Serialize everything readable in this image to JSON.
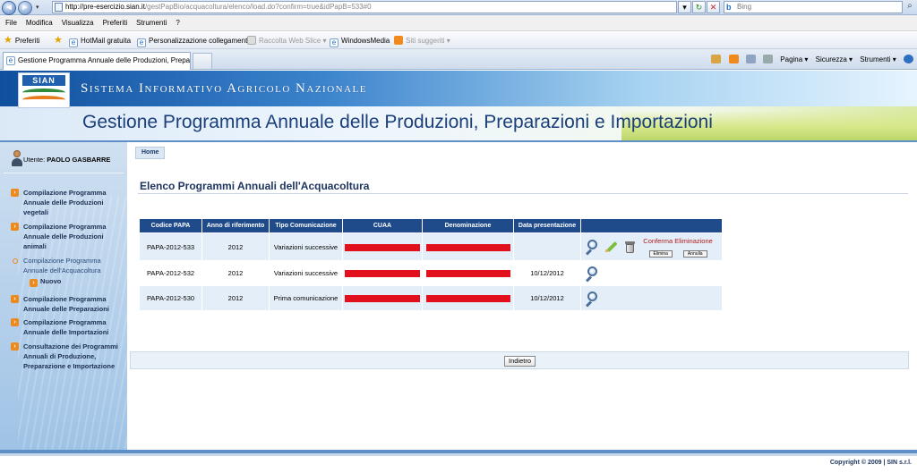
{
  "browser": {
    "url_host": "http://pre-esercizio.sian.it",
    "url_path": "/gestPapBio/acquacoltura/elenco/load.do?confirm=true&idPapB=533#0",
    "search_placeholder": "Bing",
    "menu": [
      "File",
      "Modifica",
      "Visualizza",
      "Preferiti",
      "Strumenti",
      "?"
    ],
    "favorites_label": "Preferiti",
    "favbar": [
      {
        "label": "HotMail gratuita"
      },
      {
        "label": "Personalizzazione collegamenti"
      },
      {
        "label": "Raccolta Web Slice ▾"
      },
      {
        "label": "WindowsMedia"
      },
      {
        "label": "Siti suggeriti ▾"
      }
    ],
    "tab_title": "Gestione Programma Annuale delle Produzioni, Prepar...",
    "commands": [
      "Pagina ▾",
      "Sicurezza ▾",
      "Strumenti ▾"
    ]
  },
  "banner": {
    "logo": "SIAN",
    "subtitle": "Sistema Informativo Agricolo Nazionale",
    "title": "Gestione Programma Annuale delle Produzioni, Preparazioni e Importazioni"
  },
  "sidebar": {
    "user_prefix": "Utente:",
    "user_name": "PAOLO GASBARRE",
    "items": [
      {
        "label": "Compilazione Programma Annuale delle Produzioni vegetali"
      },
      {
        "label": "Compilazione Programma Annuale delle Produzioni animali"
      },
      {
        "label": "Compilazione Programma Annuale dell'Acquacoltura"
      },
      {
        "label": "Compilazione Programma Annuale delle Preparazioni"
      },
      {
        "label": "Compilazione Programma Annuale delle Importazioni"
      },
      {
        "label": "Consultazione dei Programmi Annuali di Produzione, Preparazione e Importazione"
      }
    ],
    "sub_item": "Nuovo"
  },
  "main": {
    "breadcrumb": "Home",
    "section_title": "Elenco Programmi Annuali dell'Acquacoltura",
    "columns": [
      "Codice PAPA",
      "Anno di riferimento",
      "Tipo Comunicazione",
      "CUAA",
      "Denominazione",
      "Data presentazione",
      ""
    ],
    "rows": [
      {
        "codice": "PAPA-2012-533",
        "anno": "2012",
        "tipo": "Variazioni successive",
        "data": ""
      },
      {
        "codice": "PAPA-2012-532",
        "anno": "2012",
        "tipo": "Variazioni successive",
        "data": "10/12/2012"
      },
      {
        "codice": "PAPA-2012-530",
        "anno": "2012",
        "tipo": "Prima comunicazione",
        "data": "10/12/2012"
      }
    ],
    "confirm_label": "Conferma Eliminazione",
    "confirm_delete": "Elimina",
    "confirm_cancel": "Annulla",
    "back_button": "Indietro"
  },
  "footer": {
    "copyright": "Copyright © 2009 | SIN s.r.l."
  }
}
